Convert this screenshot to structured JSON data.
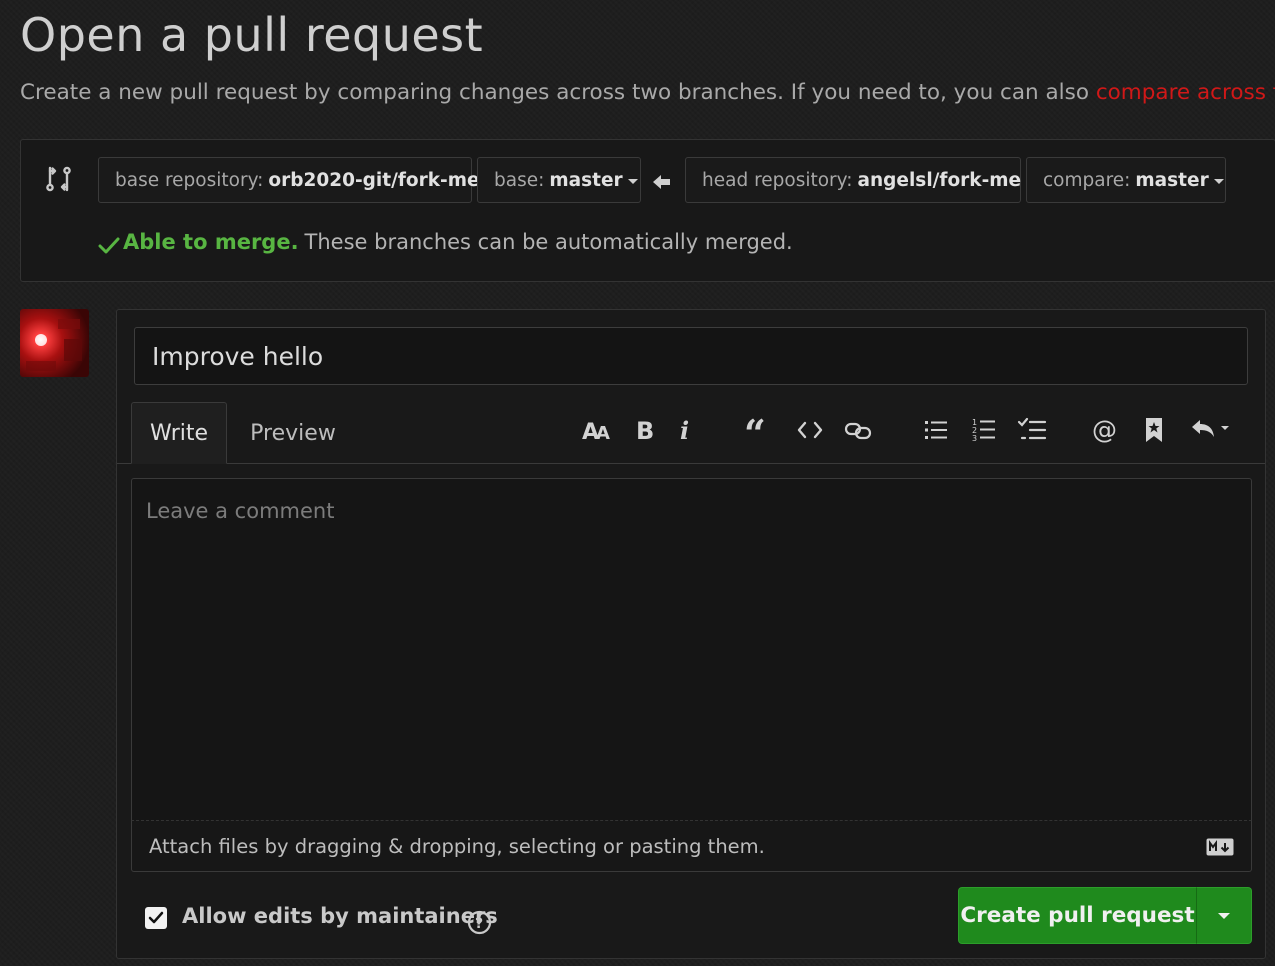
{
  "header": {
    "title": "Open a pull request",
    "subtitle": "Create a new pull request by comparing changes across two branches. If you need to, you can also ",
    "subtitle_link": "compare across forks",
    "subtitle_end": "."
  },
  "compare": {
    "base_repo_label": "base repository:",
    "base_repo_value": "orb2020-git/fork-me",
    "base_label": "base:",
    "base_value": "master",
    "head_repo_label": "head repository:",
    "head_repo_value": "angelsl/fork-me",
    "compare_label": "compare:",
    "compare_value": "master",
    "merge_ok": "Able to merge.",
    "merge_text": "These branches can be automatically merged."
  },
  "form": {
    "title_value": "Improve hello",
    "tabs": [
      "Write",
      "Preview"
    ],
    "comment_placeholder": "Leave a comment",
    "attach_text": "Attach files by dragging & dropping, selecting or pasting them.",
    "allow_edits_label": "Allow edits by maintainers",
    "allow_edits_checked": true,
    "create_button": "Create pull request"
  },
  "toolbar": {
    "icons": [
      "text-size-icon",
      "bold-icon",
      "italic-icon",
      "quote-icon",
      "code-icon",
      "link-icon",
      "unordered-list-icon",
      "ordered-list-icon",
      "task-list-icon",
      "mention-icon",
      "bookmark-icon",
      "reply-icon"
    ]
  },
  "colors": {
    "background": "#1e1e1e",
    "link": "#d01818",
    "success": "#58b542",
    "button": "#1f8a1d"
  }
}
